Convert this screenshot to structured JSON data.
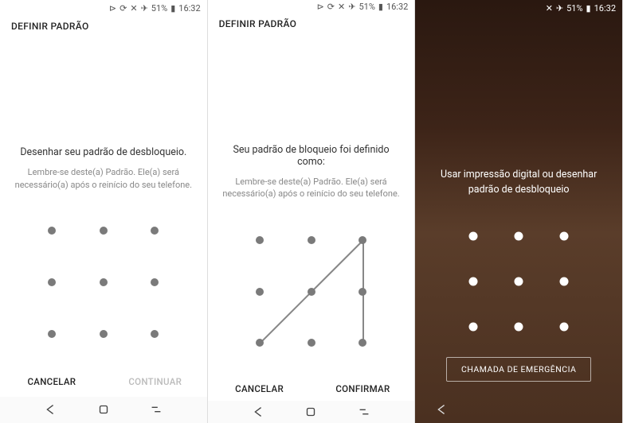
{
  "status": {
    "battery": "51%",
    "time": "16:32"
  },
  "panel1": {
    "header": "DEFINIR PADRÃO",
    "main": "Desenhar seu padrão de desbloqueio.",
    "sub": "Lembre-se deste(a) Padrão. Ele(a) será necessário(a) após o reinício do seu telefone.",
    "cancel": "CANCELAR",
    "continue": "CONTINUAR"
  },
  "panel2": {
    "header": "DEFINIR PADRÃO",
    "main": "Seu padrão de bloqueio foi definido como:",
    "sub": "Lembre-se deste(a) Padrão. Ele(a) será necessário(a) após o reinício do seu telefone.",
    "cancel": "CANCELAR",
    "confirm": "CONFIRMAR"
  },
  "panel3": {
    "main": "Usar impressão digital ou desenhar padrão de desbloqueio",
    "emergency": "CHAMADA DE EMERGÊNCIA"
  }
}
